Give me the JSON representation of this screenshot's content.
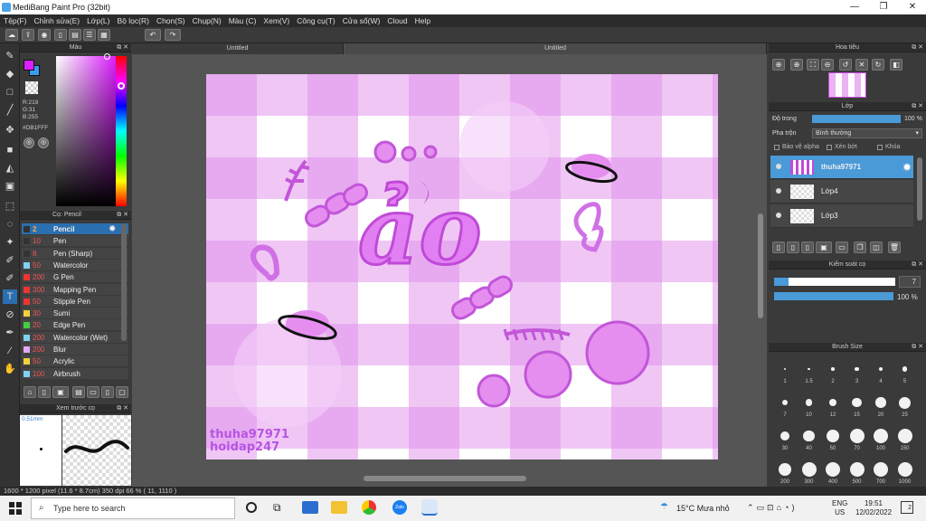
{
  "window": {
    "title": "MediBang Paint Pro (32bit)",
    "min_label": "—",
    "max_label": "❐",
    "close_label": "✕"
  },
  "menu": [
    "Tệp(F)",
    "Chỉnh sửa(E)",
    "Lớp(L)",
    "Bộ lọc(R)",
    "Chọn(S)",
    "Chụp(N)",
    "Màu (C)",
    "Xem(V)",
    "Công cụ(T)",
    "Cửa sổ(W)",
    "Cloud",
    "Help"
  ],
  "toolbar": {
    "undo": "↶",
    "redo": "↷"
  },
  "color_panel": {
    "title": "Màu",
    "rgb": [
      "R:219",
      "G:31",
      "B:255"
    ],
    "hex": "#DB1FFF",
    "primary_color": "#db1fff",
    "secondary_color": "#3a9df0"
  },
  "brush_panel": {
    "title": "Cọ: Pencil",
    "brushes": [
      {
        "size": "2",
        "name": "Pencil",
        "color": "#333333",
        "selected": true
      },
      {
        "size": "10",
        "name": "Pen",
        "color": "#333333"
      },
      {
        "size": "8",
        "name": "Pen (Sharp)",
        "color": "#333333"
      },
      {
        "size": "50",
        "name": "Watercolor",
        "color": "#7fd2f2"
      },
      {
        "size": "200",
        "name": "G Pen",
        "color": "#ee3333"
      },
      {
        "size": "300",
        "name": "Mapping Pen",
        "color": "#ee3333"
      },
      {
        "size": "50",
        "name": "Stipple Pen",
        "color": "#ee3333"
      },
      {
        "size": "30",
        "name": "Sumi",
        "color": "#f2d23a"
      },
      {
        "size": "20",
        "name": "Edge Pen",
        "color": "#44cc44"
      },
      {
        "size": "200",
        "name": "Watercolor (Wet)",
        "color": "#7fd2f2"
      },
      {
        "size": "200",
        "name": "Blur",
        "color": "#e4a8ff"
      },
      {
        "size": "50",
        "name": "Acrylic",
        "color": "#f2d23a"
      },
      {
        "size": "100",
        "name": "Airbrush",
        "color": "#7fd2f2"
      }
    ]
  },
  "preview_panel": {
    "title": "Xem trước cọ",
    "size_label": "0.51mm"
  },
  "tabs": [
    "Untitled",
    "Untitled"
  ],
  "canvas": {
    "big_text": "ảo",
    "watermark_lines": [
      "thuha97971",
      "hoidap247"
    ]
  },
  "navigator": {
    "title": "Hoa tiêu"
  },
  "layer_panel": {
    "title": "Lớp",
    "opacity_label": "Độ trong",
    "opacity_value": "100 %",
    "opacity_fraction": 1.0,
    "blend_label": "Pha trộn",
    "blend_value": "Bình thường",
    "protect_alpha": "Bảo vệ alpha",
    "clipping": "Xén bớt",
    "lock": "Khóa",
    "layers": [
      {
        "name": "thuha97971",
        "selected": true
      },
      {
        "name": "Lớp4"
      },
      {
        "name": "Lớp3"
      }
    ]
  },
  "brush_control": {
    "title": "Kiểm soát cọ",
    "size_value": "7",
    "size_fraction": 0.12,
    "opacity_value": "100 %",
    "opacity_fraction": 1.0
  },
  "brush_size_panel": {
    "title": "Brush Size",
    "sizes": [
      "1",
      "1.5",
      "2",
      "3",
      "4",
      "5",
      "7",
      "10",
      "12",
      "15",
      "20",
      "25",
      "30",
      "40",
      "50",
      "70",
      "100",
      "150",
      "200",
      "300",
      "400",
      "500",
      "700",
      "1000"
    ]
  },
  "status": {
    "text": "1600 * 1200 pixel    (11.6 * 8.7cm)    350 dpi    66 %    ( 11, 1110 )"
  },
  "taskbar": {
    "search_placeholder": "Type here to search",
    "weather": "15°C  Mưa nhỏ",
    "lang": "ENG",
    "region": "US",
    "time": "19:51",
    "date": "12/02/2022",
    "notif": "2"
  }
}
